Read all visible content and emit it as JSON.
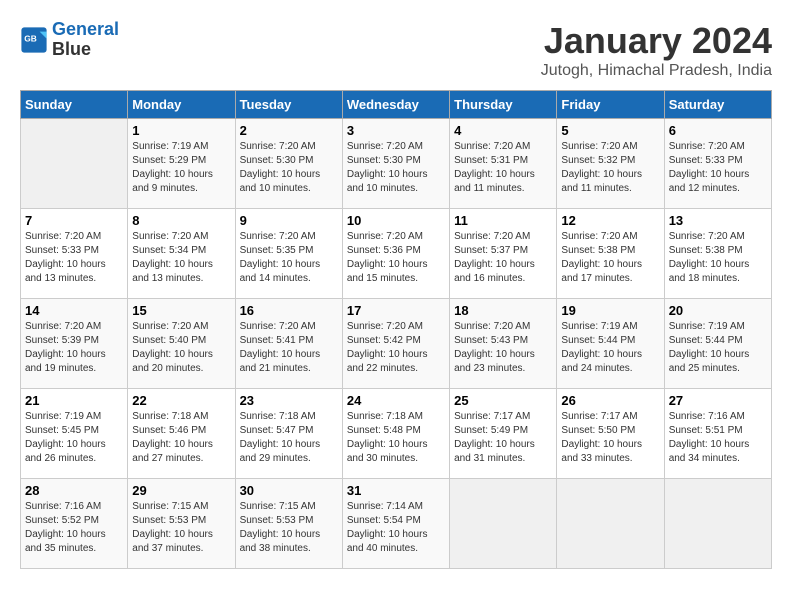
{
  "header": {
    "logo_line1": "General",
    "logo_line2": "Blue",
    "title": "January 2024",
    "subtitle": "Jutogh, Himachal Pradesh, India"
  },
  "weekdays": [
    "Sunday",
    "Monday",
    "Tuesday",
    "Wednesday",
    "Thursday",
    "Friday",
    "Saturday"
  ],
  "weeks": [
    [
      {
        "num": "",
        "info": ""
      },
      {
        "num": "1",
        "info": "Sunrise: 7:19 AM\nSunset: 5:29 PM\nDaylight: 10 hours\nand 9 minutes."
      },
      {
        "num": "2",
        "info": "Sunrise: 7:20 AM\nSunset: 5:30 PM\nDaylight: 10 hours\nand 10 minutes."
      },
      {
        "num": "3",
        "info": "Sunrise: 7:20 AM\nSunset: 5:30 PM\nDaylight: 10 hours\nand 10 minutes."
      },
      {
        "num": "4",
        "info": "Sunrise: 7:20 AM\nSunset: 5:31 PM\nDaylight: 10 hours\nand 11 minutes."
      },
      {
        "num": "5",
        "info": "Sunrise: 7:20 AM\nSunset: 5:32 PM\nDaylight: 10 hours\nand 11 minutes."
      },
      {
        "num": "6",
        "info": "Sunrise: 7:20 AM\nSunset: 5:33 PM\nDaylight: 10 hours\nand 12 minutes."
      }
    ],
    [
      {
        "num": "7",
        "info": "Sunrise: 7:20 AM\nSunset: 5:33 PM\nDaylight: 10 hours\nand 13 minutes."
      },
      {
        "num": "8",
        "info": "Sunrise: 7:20 AM\nSunset: 5:34 PM\nDaylight: 10 hours\nand 13 minutes."
      },
      {
        "num": "9",
        "info": "Sunrise: 7:20 AM\nSunset: 5:35 PM\nDaylight: 10 hours\nand 14 minutes."
      },
      {
        "num": "10",
        "info": "Sunrise: 7:20 AM\nSunset: 5:36 PM\nDaylight: 10 hours\nand 15 minutes."
      },
      {
        "num": "11",
        "info": "Sunrise: 7:20 AM\nSunset: 5:37 PM\nDaylight: 10 hours\nand 16 minutes."
      },
      {
        "num": "12",
        "info": "Sunrise: 7:20 AM\nSunset: 5:38 PM\nDaylight: 10 hours\nand 17 minutes."
      },
      {
        "num": "13",
        "info": "Sunrise: 7:20 AM\nSunset: 5:38 PM\nDaylight: 10 hours\nand 18 minutes."
      }
    ],
    [
      {
        "num": "14",
        "info": "Sunrise: 7:20 AM\nSunset: 5:39 PM\nDaylight: 10 hours\nand 19 minutes."
      },
      {
        "num": "15",
        "info": "Sunrise: 7:20 AM\nSunset: 5:40 PM\nDaylight: 10 hours\nand 20 minutes."
      },
      {
        "num": "16",
        "info": "Sunrise: 7:20 AM\nSunset: 5:41 PM\nDaylight: 10 hours\nand 21 minutes."
      },
      {
        "num": "17",
        "info": "Sunrise: 7:20 AM\nSunset: 5:42 PM\nDaylight: 10 hours\nand 22 minutes."
      },
      {
        "num": "18",
        "info": "Sunrise: 7:20 AM\nSunset: 5:43 PM\nDaylight: 10 hours\nand 23 minutes."
      },
      {
        "num": "19",
        "info": "Sunrise: 7:19 AM\nSunset: 5:44 PM\nDaylight: 10 hours\nand 24 minutes."
      },
      {
        "num": "20",
        "info": "Sunrise: 7:19 AM\nSunset: 5:44 PM\nDaylight: 10 hours\nand 25 minutes."
      }
    ],
    [
      {
        "num": "21",
        "info": "Sunrise: 7:19 AM\nSunset: 5:45 PM\nDaylight: 10 hours\nand 26 minutes."
      },
      {
        "num": "22",
        "info": "Sunrise: 7:18 AM\nSunset: 5:46 PM\nDaylight: 10 hours\nand 27 minutes."
      },
      {
        "num": "23",
        "info": "Sunrise: 7:18 AM\nSunset: 5:47 PM\nDaylight: 10 hours\nand 29 minutes."
      },
      {
        "num": "24",
        "info": "Sunrise: 7:18 AM\nSunset: 5:48 PM\nDaylight: 10 hours\nand 30 minutes."
      },
      {
        "num": "25",
        "info": "Sunrise: 7:17 AM\nSunset: 5:49 PM\nDaylight: 10 hours\nand 31 minutes."
      },
      {
        "num": "26",
        "info": "Sunrise: 7:17 AM\nSunset: 5:50 PM\nDaylight: 10 hours\nand 33 minutes."
      },
      {
        "num": "27",
        "info": "Sunrise: 7:16 AM\nSunset: 5:51 PM\nDaylight: 10 hours\nand 34 minutes."
      }
    ],
    [
      {
        "num": "28",
        "info": "Sunrise: 7:16 AM\nSunset: 5:52 PM\nDaylight: 10 hours\nand 35 minutes."
      },
      {
        "num": "29",
        "info": "Sunrise: 7:15 AM\nSunset: 5:53 PM\nDaylight: 10 hours\nand 37 minutes."
      },
      {
        "num": "30",
        "info": "Sunrise: 7:15 AM\nSunset: 5:53 PM\nDaylight: 10 hours\nand 38 minutes."
      },
      {
        "num": "31",
        "info": "Sunrise: 7:14 AM\nSunset: 5:54 PM\nDaylight: 10 hours\nand 40 minutes."
      },
      {
        "num": "",
        "info": ""
      },
      {
        "num": "",
        "info": ""
      },
      {
        "num": "",
        "info": ""
      }
    ]
  ]
}
